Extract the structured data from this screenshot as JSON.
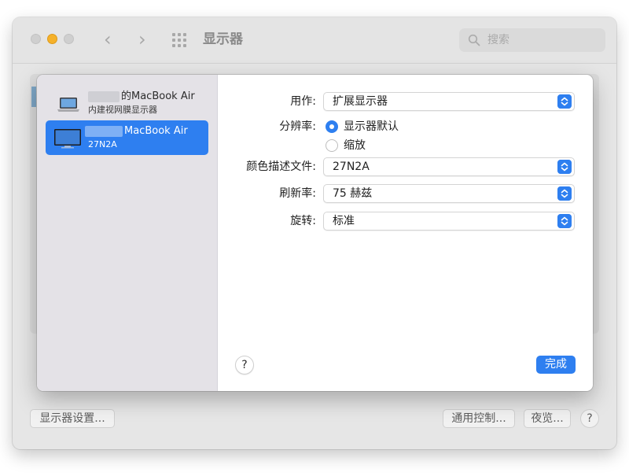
{
  "window": {
    "title": "显示器",
    "search_placeholder": "搜索"
  },
  "bottom_bar": {
    "display_settings": "显示器设置...",
    "universal_control": "通用控制...",
    "night_shift": "夜览...",
    "help": "?"
  },
  "sidebar": {
    "displays": [
      {
        "name": "的MacBook Air",
        "subtitle": "内建视网膜显示器",
        "icon": "laptop-icon",
        "selected": false
      },
      {
        "name": "MacBook Air",
        "subtitle": "27N2A",
        "icon": "monitor-icon",
        "selected": true
      }
    ]
  },
  "settings": {
    "use_as": {
      "label": "用作:",
      "value": "扩展显示器"
    },
    "resolution": {
      "label": "分辨率:",
      "options": [
        {
          "label": "显示器默认",
          "selected": true
        },
        {
          "label": "缩放",
          "selected": false
        }
      ]
    },
    "color_profile": {
      "label": "颜色描述文件:",
      "value": "27N2A"
    },
    "refresh_rate": {
      "label": "刷新率:",
      "value": "75 赫兹"
    },
    "rotation": {
      "label": "旋转:",
      "value": "标准"
    }
  },
  "footer": {
    "help": "?",
    "done": "完成"
  },
  "colors": {
    "accent": "#2e7ff0",
    "sidebar": "#e4e2e7",
    "traffic_yellow": "#f5b12a"
  }
}
